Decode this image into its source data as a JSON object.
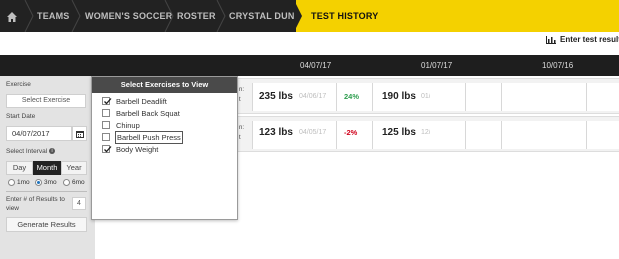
{
  "breadcrumb": {
    "items": [
      "TEAMS",
      "WOMEN'S SOCCER",
      "ROSTER",
      "CRYSTAL DUNN"
    ],
    "active": "TEST HISTORY"
  },
  "actions": {
    "enter_results": "Enter test results"
  },
  "dates": [
    "04/07/17",
    "01/07/17",
    "10/07/16"
  ],
  "left_panel": {
    "exercise_label": "Exercise",
    "exercise_select": "Select Exercise",
    "start_date_label": "Start Date",
    "start_date_value": "04/07/2017",
    "interval_label": "Select Interval",
    "interval_options": [
      "Day",
      "Month",
      "Year"
    ],
    "interval_active": "Month",
    "range_options": [
      "1mo",
      "3mo",
      "6mo"
    ],
    "range_selected": "3mo",
    "num_results_label": "Enter # of Results to view",
    "num_results_value": "4",
    "generate_button": "Generate Results"
  },
  "dropdown": {
    "title": "Select Exercises to View",
    "items": [
      {
        "label": "Barbell Deadlift",
        "checked": true
      },
      {
        "label": "Barbell Back Squat",
        "checked": false
      },
      {
        "label": "Chinup",
        "checked": false
      },
      {
        "label": "Barbell Push Press",
        "checked": false
      },
      {
        "label": "Body Weight",
        "checked": true
      }
    ]
  },
  "rows": [
    {
      "cut": [
        "n:",
        "t"
      ],
      "value": "235 lbs",
      "prev_date": "04/06/17",
      "change": "24%",
      "change_color": "#2e9e4f",
      "value2": "190 lbs",
      "prev_date2": "01/01/17"
    },
    {
      "cut": [
        "n:",
        "t"
      ],
      "value": "123 lbs",
      "prev_date": "04/05/17",
      "change": "-2%",
      "change_color": "#d0021b",
      "value2": "125 lbs",
      "prev_date2": "12/06/16"
    }
  ]
}
